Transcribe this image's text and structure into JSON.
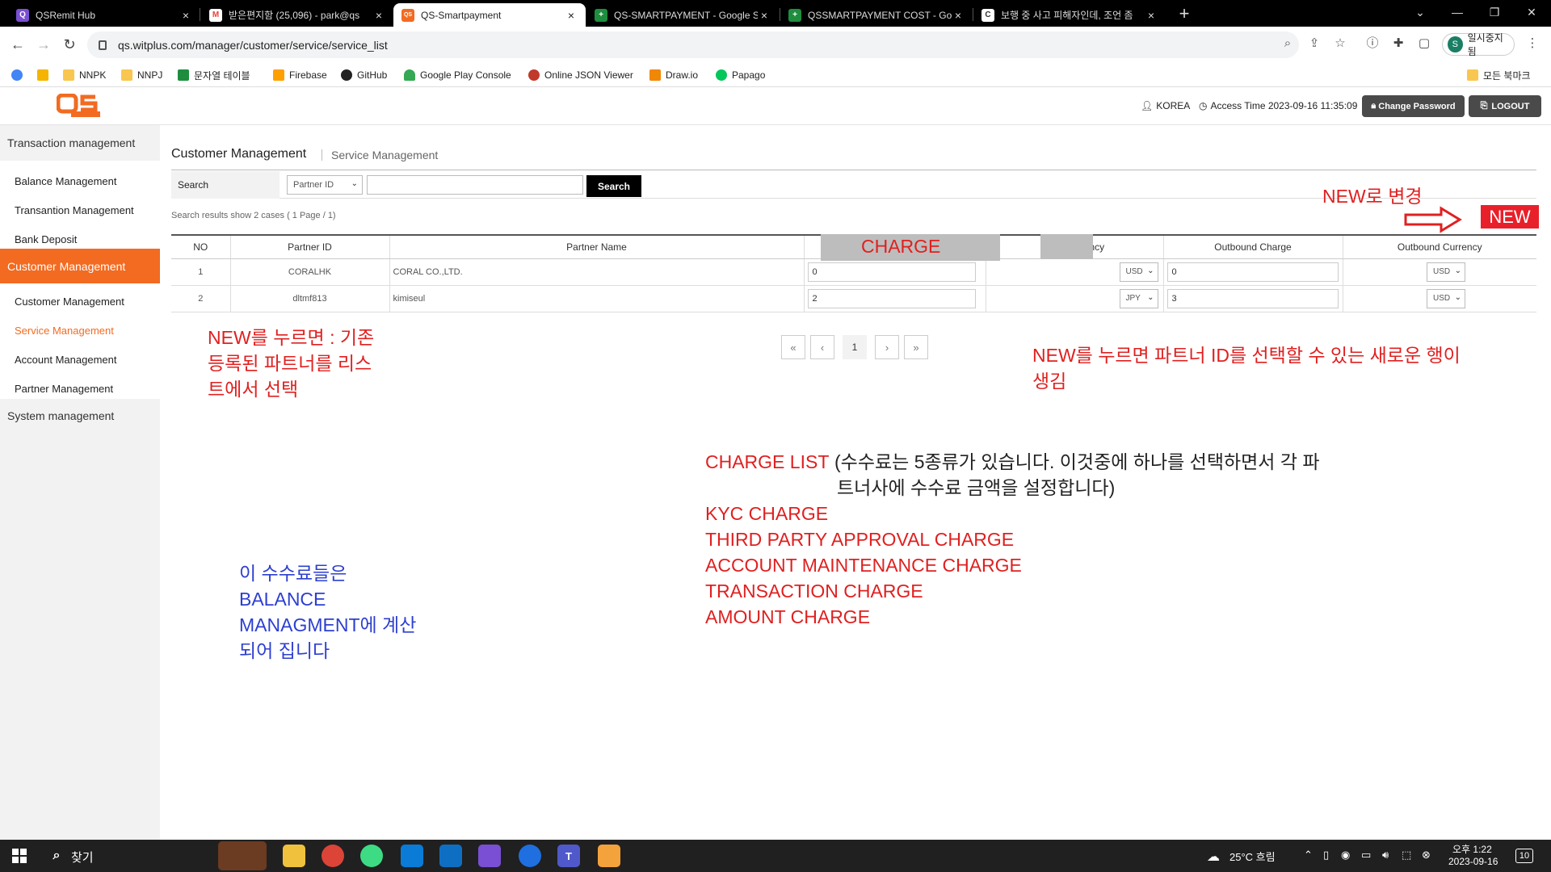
{
  "browser": {
    "tabs": [
      {
        "label": "QSRemit Hub",
        "icon_color": "#7a4fd3",
        "icon_char": "Q",
        "active": false
      },
      {
        "label": "받은편지함 (25,096) - park@qs",
        "icon_color": "#ea4335",
        "icon_char": "M",
        "active": false
      },
      {
        "label": "QS-Smartpayment",
        "icon_color": "#f26b21",
        "icon_char": "QS",
        "active": true
      },
      {
        "label": "QS-SMARTPAYMENT - Google S",
        "icon_color": "#1e8e3e",
        "icon_char": "+",
        "active": false
      },
      {
        "label": "QSSMARTPAYMENT COST - Goo",
        "icon_color": "#1e8e3e",
        "icon_char": "+",
        "active": false
      },
      {
        "label": "보행 중 사고 피해자인데, 조언 좀",
        "icon_color": "#555555",
        "icon_char": "C",
        "active": false
      }
    ],
    "close_glyph": "×",
    "new_tab_glyph": "+",
    "url": "qs.witplus.com/manager/customer/service/service_list",
    "profile_initial": "S",
    "profile_label": "일시중지됨",
    "bookmarks": [
      {
        "label": "",
        "icon_color": "#4285f4"
      },
      {
        "label": "",
        "icon_color": "#f4b400"
      },
      {
        "label": "NNPK",
        "icon_color": "#f9c74f"
      },
      {
        "label": "NNPJ",
        "icon_color": "#f9c74f"
      },
      {
        "label": "문자열 테이블",
        "icon_color": "#1e8e3e"
      },
      {
        "label": "Firebase",
        "icon_color": "#ffa000"
      },
      {
        "label": "GitHub",
        "icon_color": "#222222"
      },
      {
        "label": "Google Play Console",
        "icon_color": "#34a853"
      },
      {
        "label": "Online JSON Viewer",
        "icon_color": "#c0392b"
      },
      {
        "label": "Draw.io",
        "icon_color": "#f08705"
      },
      {
        "label": "Papago",
        "icon_color": "#03c75a"
      }
    ],
    "bookmarks_folder": "모든 북마크"
  },
  "header": {
    "user": "KOREA",
    "access_time": "Access Time 2023-09-16 11:35:09",
    "change_password": "Change Password",
    "logout": "LOGOUT"
  },
  "sidebar": {
    "groups": [
      {
        "label": "Transaction management",
        "active": false,
        "items": [
          {
            "label": "Balance Management",
            "active": false
          },
          {
            "label": "Transantion Management",
            "active": false
          },
          {
            "label": "Bank Deposit",
            "active": false
          }
        ]
      },
      {
        "label": "Customer Management",
        "active": true,
        "items": [
          {
            "label": "Customer Management",
            "active": false
          },
          {
            "label": "Service Management",
            "active": true
          },
          {
            "label": "Account Management",
            "active": false
          },
          {
            "label": "Partner Management",
            "active": false
          }
        ]
      },
      {
        "label": "System management",
        "active": false,
        "items": []
      }
    ]
  },
  "main": {
    "title": "Customer Management",
    "subtitle": "Service Management",
    "search": {
      "label": "Search",
      "field_select": "Partner ID",
      "input_value": "",
      "button": "Search"
    },
    "results_info": "Search results show 2 cases ( 1 Page / 1)",
    "table": {
      "columns": [
        "NO",
        "Partner ID",
        "Partner Name",
        "",
        "Currency",
        "Outbound Charge",
        "Outbound Currency"
      ],
      "rows": [
        {
          "no": "1",
          "partner_id": "CORALHK",
          "partner_name": "CORAL CO.,LTD.",
          "charge": "0",
          "currency": "USD",
          "outbound_charge": "0",
          "outbound_currency": "USD"
        },
        {
          "no": "2",
          "partner_id": "dltmf813",
          "partner_name": "kimiseul",
          "charge": "2",
          "currency": "JPY",
          "outbound_charge": "3",
          "outbound_currency": "USD"
        }
      ]
    },
    "pagination": {
      "first": "«",
      "prev": "‹",
      "current": "1",
      "next": "›",
      "last": "»"
    }
  },
  "annotations": {
    "charge_header": "CHARGE",
    "new_label": "NEW로 변경",
    "new_button": "NEW",
    "left_note": [
      "NEW를 누르면 : 기존",
      "등록된 파트너를 리스",
      "트에서 선택"
    ],
    "right_note": [
      "NEW를 누르면 파트너 ID를 선택할 수 있는 새로운 행이",
      "생김"
    ],
    "charge_list_title": "CHARGE LIST",
    "charge_list_desc": [
      "(수수료는 5종류가 있습니다. 이것중에 하나를 선택하면서 각 파",
      "트너사에 수수료 금액을 설정합니다)"
    ],
    "charge_list": [
      "KYC CHARGE",
      "THIRD PARTY APPROVAL CHARGE",
      "ACCOUNT MAINTENANCE CHARGE",
      "TRANSACTION CHARGE",
      "AMOUNT CHARGE"
    ],
    "blue_note": [
      "이 수수료들은",
      "BALANCE",
      "MANAGMENT에 계산",
      "되어 집니다"
    ],
    "red": "#e02020",
    "blue": "#2d3fd0"
  },
  "taskbar": {
    "search_label": "찾기",
    "weather": "25°C 흐림",
    "time_top": "오후 1:22",
    "time_bottom": "2023-09-16",
    "notif_count": "10"
  },
  "colors": {
    "accent": "#f26b21",
    "sidebar_bg": "#f2f2f2",
    "dark_button": "#4a4a4a"
  }
}
